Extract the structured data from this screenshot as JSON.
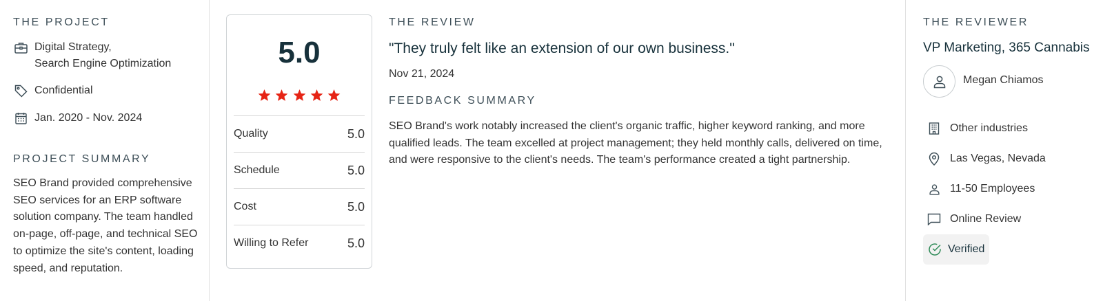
{
  "project": {
    "heading": "THE PROJECT",
    "services_line1": "Digital Strategy,",
    "services_line2": "Search Engine Optimization",
    "budget": "Confidential",
    "dates": "Jan. 2020 - Nov. 2024",
    "summary_heading": "PROJECT SUMMARY",
    "summary": "SEO Brand provided comprehensive SEO services for an ERP software solution company. The team handled on-page, off-page, and technical SEO to optimize the site's content, loading speed, and reputation.",
    "icons": {
      "services": "briefcase-icon",
      "budget": "tag-icon",
      "dates": "calendar-icon"
    }
  },
  "rating": {
    "overall": "5.0",
    "stars": 5,
    "star_color": "#e62415",
    "rows": [
      {
        "label": "Quality",
        "value": "5.0"
      },
      {
        "label": "Schedule",
        "value": "5.0"
      },
      {
        "label": "Cost",
        "value": "5.0"
      },
      {
        "label": "Willing to Refer",
        "value": "5.0"
      }
    ]
  },
  "review": {
    "heading": "THE REVIEW",
    "quote": "\"They truly felt like an extension of our own business.\"",
    "date": "Nov 21, 2024",
    "feedback_heading": "FEEDBACK SUMMARY",
    "feedback": "SEO Brand's work notably increased the client's organic traffic, higher keyword ranking, and more qualified leads. The team excelled at project management; they held monthly calls, delivered on time, and were responsive to the client's needs. The team's performance created a tight partnership."
  },
  "reviewer": {
    "heading": "THE REVIEWER",
    "title": "VP Marketing, 365 Cannabis",
    "name": "Megan Chiamos",
    "industry": "Other industries",
    "location": "Las Vegas, Nevada",
    "employees": "11-50 Employees",
    "review_type": "Online Review",
    "verified": "Verified",
    "verified_color": "#2e8b57",
    "icons": {
      "avatar": "person-icon",
      "industry": "building-icon",
      "location": "map-pin-icon",
      "employees": "person-icon",
      "review_type": "chat-bubble-icon",
      "verified": "check-circle-icon"
    }
  }
}
